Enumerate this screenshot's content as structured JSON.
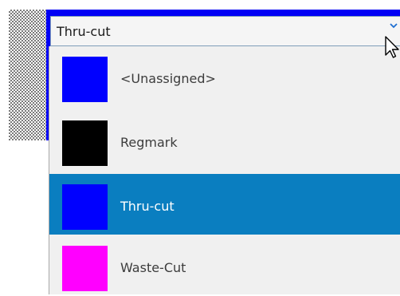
{
  "combo": {
    "value": "Thru-cut",
    "arrow_icon": "chevron-down-icon"
  },
  "dropdown": {
    "items": [
      {
        "label": "<Unassigned>",
        "color": "#0000ff",
        "selected": false
      },
      {
        "label": "Regmark",
        "color": "#000000",
        "selected": false
      },
      {
        "label": "Thru-cut",
        "color": "#0000ff",
        "selected": true
      },
      {
        "label": "Waste-Cut",
        "color": "#ff00ff",
        "selected": false
      }
    ]
  },
  "colors": {
    "frame_blue": "#0000f5",
    "selection": "#0a7ec0",
    "list_bg": "#f0f0f0"
  }
}
